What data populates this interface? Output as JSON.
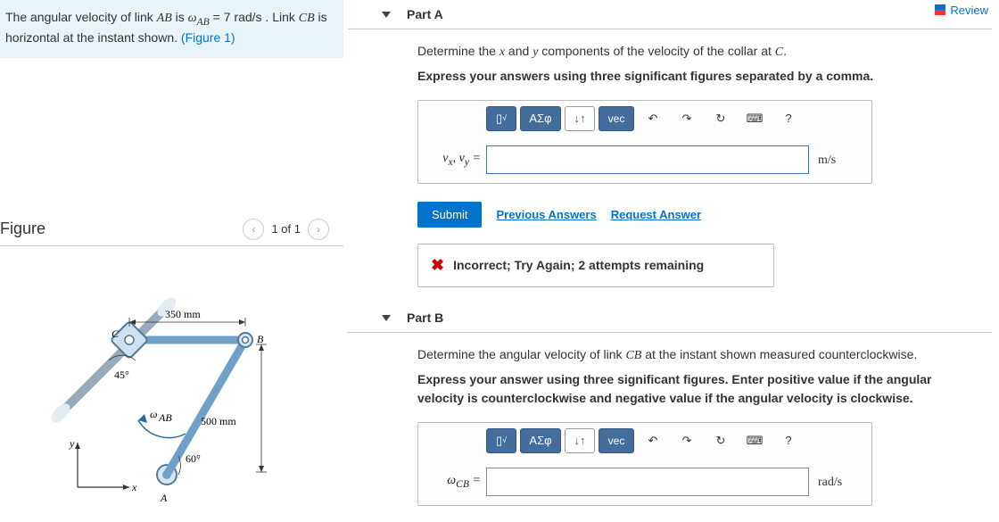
{
  "review_label": "Review",
  "problem_statement_pre": "The angular velocity of link ",
  "problem_statement_link1": "AB",
  "problem_statement_mid": " is ",
  "problem_statement_omega": "ω",
  "problem_statement_sub": "AB",
  "problem_statement_eq": " = 7  rad/s . Link ",
  "problem_statement_link2": "CB",
  "problem_statement_post": " is horizontal at the instant shown. ",
  "problem_statement_figref": "(Figure 1)",
  "figure_label": "Figure",
  "fig_page": "1 of 1",
  "fig_dim1": "350 mm",
  "fig_dim2": "500 mm",
  "fig_ang1": "45°",
  "fig_ang2": "60°",
  "fig_A": "A",
  "fig_B": "B",
  "fig_C": "C",
  "fig_x": "x",
  "fig_y": "y",
  "fig_wab": "ω",
  "fig_wab_sub": "AB",
  "partA": {
    "title": "Part A",
    "prompt_pre": "Determine the ",
    "prompt_x": "x",
    "prompt_and": " and ",
    "prompt_y": "y",
    "prompt_post": " components of the velocity of the collar at ",
    "prompt_C": "C",
    "prompt_dot": ".",
    "prompt2": "Express your answers using three significant figures separated by a comma.",
    "var_label": "v",
    "var_sub1": "x",
    "var_sep": ", ",
    "var_label2": "v",
    "var_sub2": "y",
    "var_eq": " =",
    "unit": "m/s",
    "submit": "Submit",
    "prev": "Previous Answers",
    "req": "Request Answer",
    "feedback": "Incorrect; Try Again; 2 attempts remaining"
  },
  "partB": {
    "title": "Part B",
    "prompt_pre": "Determine the angular velocity of link ",
    "prompt_CB": "CB",
    "prompt_post": " at the instant shown measured counterclockwise.",
    "prompt2": "Express your answer using three significant figures. Enter positive value if the angular velocity is counterclockwise and negative value if the angular velocity is clockwise.",
    "var_label": "ω",
    "var_sub": "CB",
    "var_eq": " =",
    "unit": "rad/s"
  },
  "toolbar": {
    "templates": "▯",
    "sqrt": "√",
    "greek": "ΑΣφ",
    "arrows": "↓↑",
    "vec": "vec",
    "undo": "↶",
    "redo": "↷",
    "reset": "↻",
    "keyboard": "⌨",
    "help": "?"
  }
}
